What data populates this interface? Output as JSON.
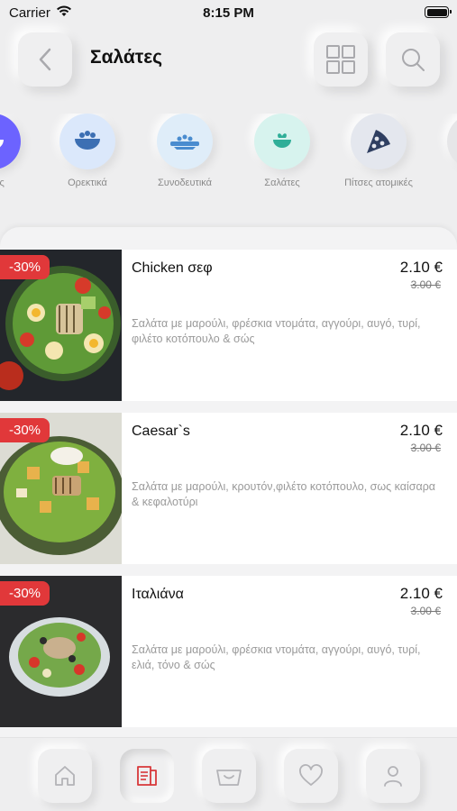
{
  "status_bar": {
    "carrier": "Carrier",
    "time": "8:15 PM"
  },
  "header": {
    "title": "Σαλάτες"
  },
  "categories": [
    {
      "label": "...ρές",
      "icon": "bowl-icon",
      "color": "#6c63ff"
    },
    {
      "label": "Ορεκτικά",
      "icon": "bowl-icon",
      "color": "#dbe8fb"
    },
    {
      "label": "Συνοδευτικά",
      "icon": "dish-icon",
      "color": "#dfedf9"
    },
    {
      "label": "Σαλάτες",
      "icon": "salad-icon",
      "color": "#d7f3ee"
    },
    {
      "label": "Πίτσες ατομικές",
      "icon": "pizza-icon",
      "color": "#e4e7ee"
    }
  ],
  "products": [
    {
      "discount": "-30%",
      "name": "Chicken σεφ",
      "price": "2.10 €",
      "old_price": "3.00 €",
      "description": "Σαλάτα με μαρούλι, φρέσκια ντομάτα, αγγούρι, αυγό, τυρί, φιλέτο κοτόπουλο & σώς"
    },
    {
      "discount": "-30%",
      "name": "Caesar`s",
      "price": "2.10 €",
      "old_price": "3.00 €",
      "description": "Σαλάτα με μαρούλι, κρουτόν,φιλέτο κοτόπουλο, σως καίσαρα & κεφαλοτύρι"
    },
    {
      "discount": "-30%",
      "name": "Ιταλιάνα",
      "price": "2.10 €",
      "old_price": "3.00 €",
      "description": "Σαλάτα με μαρούλι, φρέσκια ντομάτα, αγγούρι, αυγό, τυρί, ελιά, τόνο & σώς"
    }
  ],
  "bottom_nav": [
    {
      "icon": "home-icon",
      "active": false
    },
    {
      "icon": "menu-icon",
      "active": true
    },
    {
      "icon": "basket-icon",
      "active": false
    },
    {
      "icon": "heart-icon",
      "active": false
    },
    {
      "icon": "profile-icon",
      "active": false
    }
  ]
}
